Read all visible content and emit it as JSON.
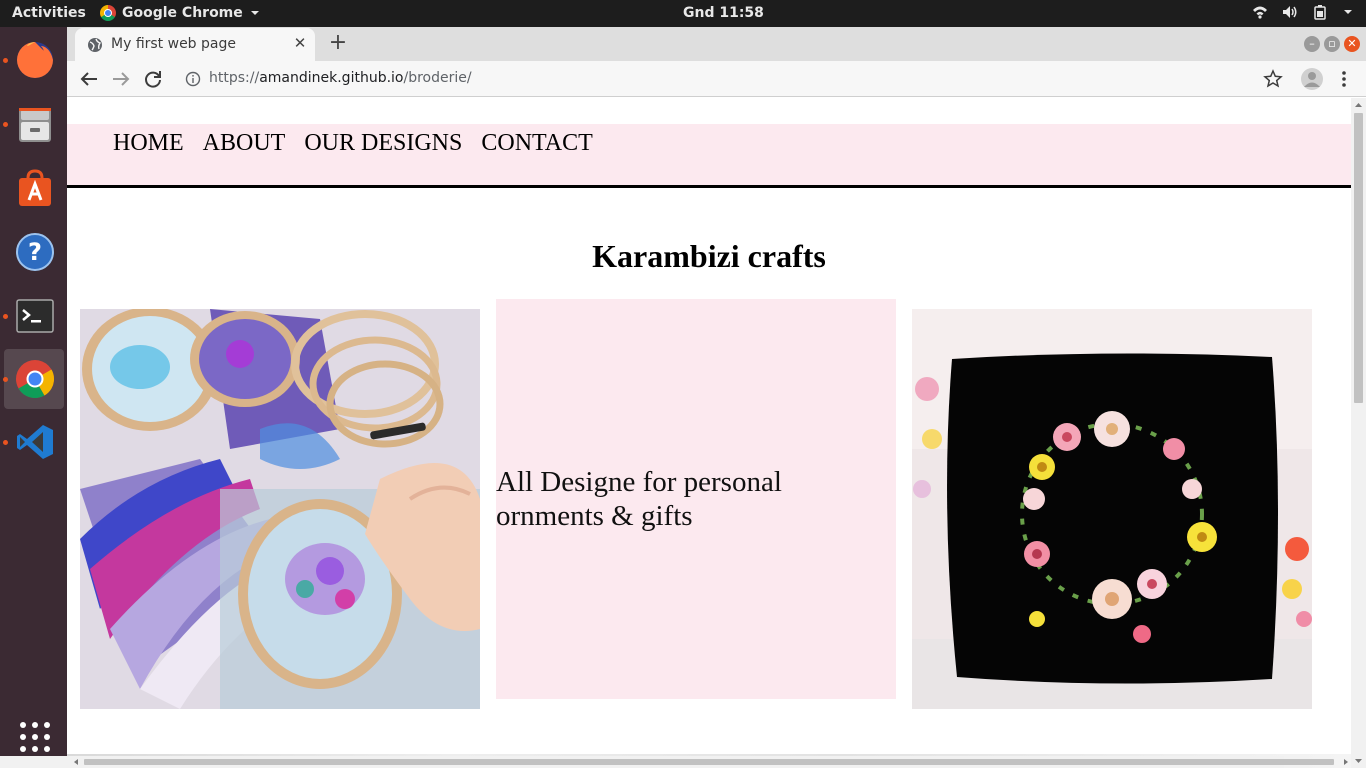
{
  "system": {
    "activities": "Activities",
    "app_name": "Google Chrome",
    "clock": "Gnd 11:58"
  },
  "browser": {
    "tab_title": "My first web page",
    "url_scheme": "https://",
    "url_host": "amandinek.github.io",
    "url_path": "/broderie/"
  },
  "page": {
    "nav": [
      "HOME",
      "ABOUT",
      "OUR DESIGNS",
      "CONTACT"
    ],
    "title": "Karambizi crafts",
    "tagline": "All Designe for personal ornments & gifts"
  },
  "colors": {
    "nav_bg": "#fce9ef",
    "panel_bg": "#fce9ef",
    "dock_bg": "#3b2a33",
    "ubuntu_orange": "#e95420"
  }
}
